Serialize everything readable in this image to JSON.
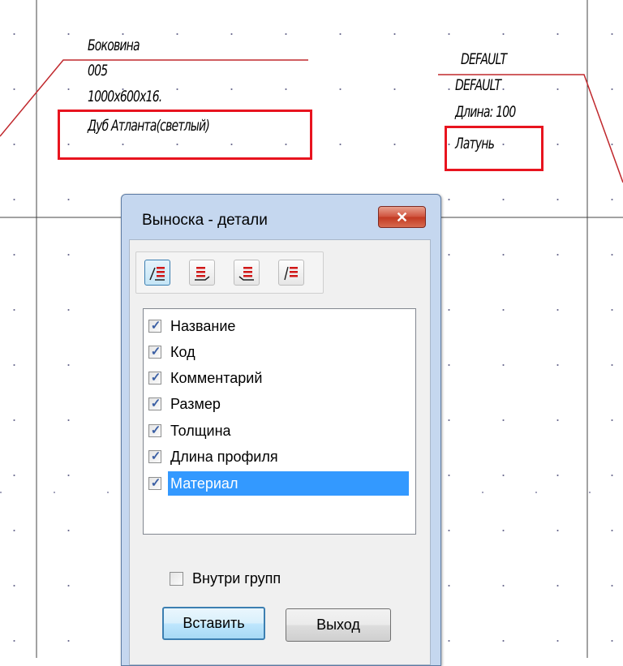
{
  "drawing": {
    "left_callout": {
      "lines": [
        "Боковина",
        "005",
        "1000x600x16.",
        "Дуб Атланта(светлый)"
      ]
    },
    "right_callout": {
      "lines": [
        "DEFAULT",
        "DEFAULT",
        "Длина: 100",
        "Латунь"
      ]
    },
    "highlight_color": "#e8141f"
  },
  "dialog": {
    "title": "Выноска - детали",
    "close_label": "✕",
    "toolbar": {
      "buttons": [
        {
          "icon": "callout-left-leader-icon",
          "active": true
        },
        {
          "icon": "callout-right-underline-icon",
          "active": false
        },
        {
          "icon": "callout-left-underline-icon",
          "active": false
        },
        {
          "icon": "callout-right-leader-icon",
          "active": false
        }
      ]
    },
    "fields": [
      {
        "label": "Название",
        "checked": true,
        "selected": false
      },
      {
        "label": "Код",
        "checked": true,
        "selected": false
      },
      {
        "label": "Комментарий",
        "checked": true,
        "selected": false
      },
      {
        "label": "Размер",
        "checked": true,
        "selected": false
      },
      {
        "label": "Толщина",
        "checked": true,
        "selected": false
      },
      {
        "label": "Длина профиля",
        "checked": true,
        "selected": false
      },
      {
        "label": "Материал",
        "checked": true,
        "selected": true
      }
    ],
    "checkmark": "✓",
    "inside_groups": {
      "label": "Внутри групп",
      "checked": false
    },
    "insert_label": "Вставить",
    "exit_label": "Выход",
    "selection_color": "#3399ff"
  }
}
